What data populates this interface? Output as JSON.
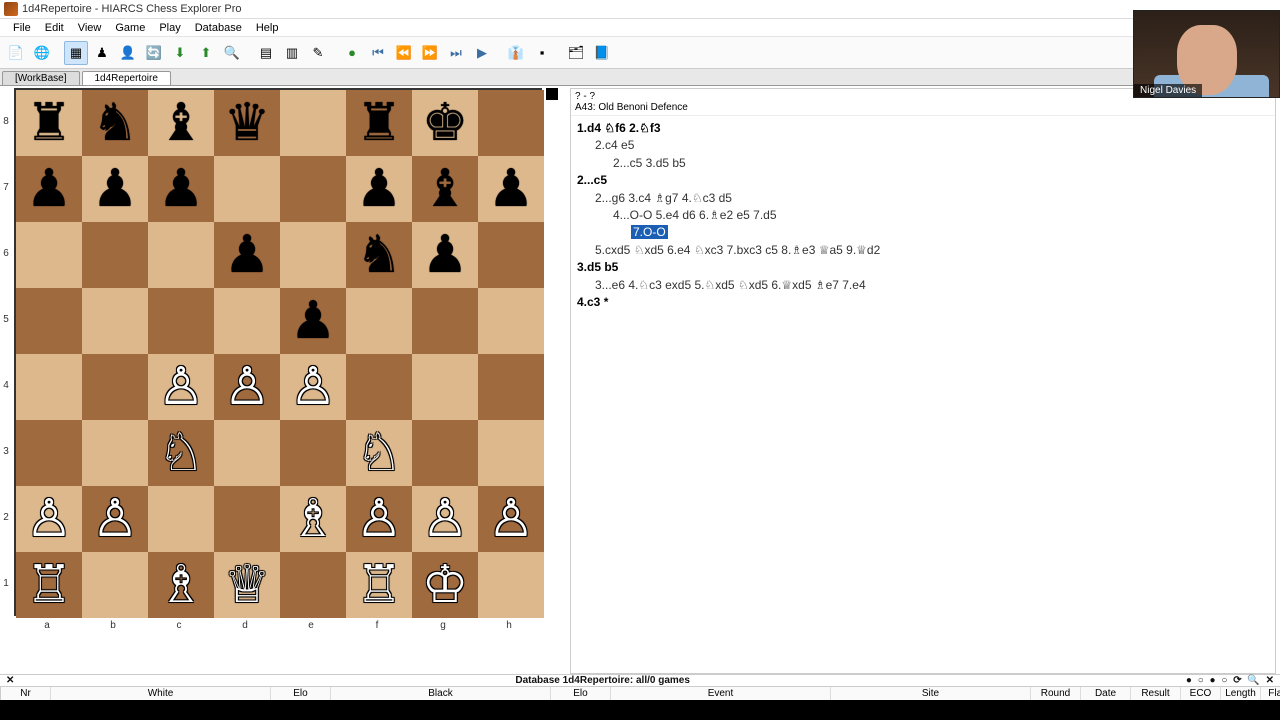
{
  "window": {
    "title": "1d4Repertoire - HIARCS Chess Explorer Pro"
  },
  "menu": [
    "File",
    "Edit",
    "View",
    "Game",
    "Play",
    "Database",
    "Help"
  ],
  "tabs": [
    {
      "label": "[WorkBase]",
      "active": false
    },
    {
      "label": "1d4Repertoire",
      "active": true
    }
  ],
  "webcam": {
    "name": "Nigel Davies"
  },
  "board": {
    "files": [
      "a",
      "b",
      "c",
      "d",
      "e",
      "f",
      "g",
      "h"
    ],
    "ranks": [
      "8",
      "7",
      "6",
      "5",
      "4",
      "3",
      "2",
      "1"
    ],
    "to_move_indicator": "black",
    "position": [
      [
        "br",
        "bn",
        "bb",
        "bq",
        "",
        "br",
        "bk",
        ""
      ],
      [
        "bp",
        "bp",
        "bp",
        "",
        "",
        "bp",
        "bb",
        "bp"
      ],
      [
        "",
        "",
        "",
        "bp",
        "",
        "bn",
        "bp",
        ""
      ],
      [
        "",
        "",
        "",
        "",
        "bp",
        "",
        "",
        ""
      ],
      [
        "",
        "",
        "wp",
        "wp",
        "wp",
        "",
        "",
        ""
      ],
      [
        "",
        "",
        "wn",
        "",
        "",
        "wn",
        "",
        ""
      ],
      [
        "wp",
        "wp",
        "",
        "",
        "wb",
        "wp",
        "wp",
        "wp"
      ],
      [
        "wr",
        "",
        "wb",
        "wq",
        "",
        "wr",
        "wk",
        ""
      ]
    ]
  },
  "notation": {
    "header_game": "? - ?",
    "header_eco": "A43: Old Benoni Defence",
    "lines": [
      {
        "cls": "mainline",
        "ind": 0,
        "text": "1.d4 ♘f6 2.♘f3"
      },
      {
        "cls": "var",
        "ind": 1,
        "text": "2.c4 e5"
      },
      {
        "cls": "var",
        "ind": 2,
        "text": "2...c5 3.d5 b5"
      },
      {
        "cls": "mainline",
        "ind": 0,
        "text": "2...c5"
      },
      {
        "cls": "var",
        "ind": 1,
        "text": "2...g6 3.c4 ♗g7 4.♘c3 d5"
      },
      {
        "cls": "var",
        "ind": 2,
        "text_pre": "4...O-O 5.e4 d6 6.♗e2 e5 7.d5",
        "text_post": ""
      },
      {
        "cls": "var hl-line",
        "ind": 3,
        "hl": "7.O-O"
      },
      {
        "cls": "var",
        "ind": 1,
        "text": "5.cxd5 ♘xd5 6.e4 ♘xc3 7.bxc3 c5 8.♗e3 ♕a5 9.♕d2"
      },
      {
        "cls": "mainline",
        "ind": 0,
        "text": "3.d5 b5"
      },
      {
        "cls": "var",
        "ind": 1,
        "text": "3...e6 4.♘c3 exd5 5.♘xd5 ♘xd5 6.♕xd5 ♗e7 7.e4"
      },
      {
        "cls": "mainline",
        "ind": 0,
        "text": "4.c3 *"
      }
    ]
  },
  "status": {
    "text": "Database 1d4Repertoire: all/0 games"
  },
  "table_columns": [
    "Nr",
    "White",
    "Elo",
    "Black",
    "Elo",
    "Event",
    "Site",
    "Round",
    "Date",
    "Result",
    "ECO",
    "Length",
    "Flags"
  ]
}
